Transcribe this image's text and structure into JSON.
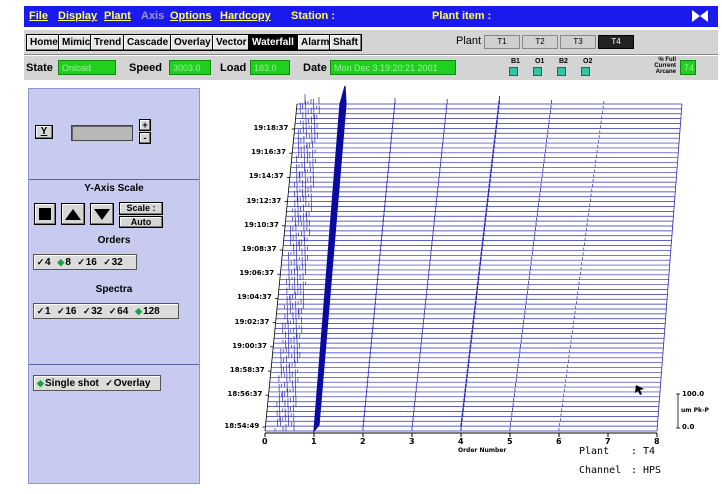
{
  "menu": {
    "items": [
      "File",
      "Display",
      "Plant",
      "Axis",
      "Options",
      "Hardcopy"
    ],
    "station_label": "Station :",
    "plant_item_label": "Plant item :"
  },
  "toolbar": {
    "buttons": [
      "Home",
      "Mimic",
      "Trend",
      "Cascade",
      "Overlay",
      "Vector",
      "Waterfall",
      "Alarm",
      "Shaft"
    ],
    "active": "Waterfall",
    "plant_label": "Plant",
    "plant_tabs": [
      "T1",
      "T2",
      "T3",
      "T4"
    ],
    "plant_selected": "T4"
  },
  "status": {
    "state_label": "State",
    "state_value": "Onload",
    "speed_label": "Speed",
    "speed_value": "3003.0",
    "load_label": "Load",
    "load_value": "183.0",
    "date_label": "Date",
    "date_value": "Mon Dec  3 19:20:21 2001",
    "leds": [
      "B1",
      "O1",
      "B2",
      "O2"
    ],
    "pct_label_lines": [
      "% Full",
      "Current",
      "Arcane"
    ],
    "pct_value": "74"
  },
  "left_panel": {
    "y_button": "Y",
    "plus": "+",
    "minus": "-",
    "y_axis_scale_title": "Y-Axis Scale",
    "scale_button": "Scale :",
    "auto_button": "Auto",
    "orders_title": "Orders",
    "orders_options": [
      "4",
      "8",
      "16",
      "32"
    ],
    "orders_selected": "8",
    "spectra_title": "Spectra",
    "spectra_options": [
      "1",
      "16",
      "32",
      "64",
      "128"
    ],
    "spectra_selected": "128",
    "mode_options": [
      "Single shot",
      "Overlay"
    ],
    "mode_selected": "Single shot"
  },
  "plot": {
    "time_labels": [
      "19:18:37",
      "19:16:37",
      "19:14:37",
      "19:12:37",
      "19:10:37",
      "19:08:37",
      "19:06:37",
      "19:04:37",
      "19:02:37",
      "19:00:37",
      "18:58:37",
      "18:56:37",
      "18:54:49"
    ],
    "x_ticks": [
      "0",
      "1",
      "2",
      "3",
      "4",
      "5",
      "6",
      "7",
      "8"
    ],
    "x_label": "Order Number",
    "scale_top": "100.0",
    "scale_unit": "um Pk-P",
    "scale_bottom": "0.0",
    "plant_info_label": "Plant",
    "plant_info_value": "T4",
    "channel_info_label": "Channel",
    "channel_info_value": "HPS"
  },
  "colors": {
    "menubar": "#1a1aee",
    "menu_text": "#ffff5a",
    "status_value_bg": "#1fd01f",
    "panel_bg": "#c7cbf0",
    "trace": "#2b2bb8",
    "peak_trace": "#0a0aa0"
  }
}
